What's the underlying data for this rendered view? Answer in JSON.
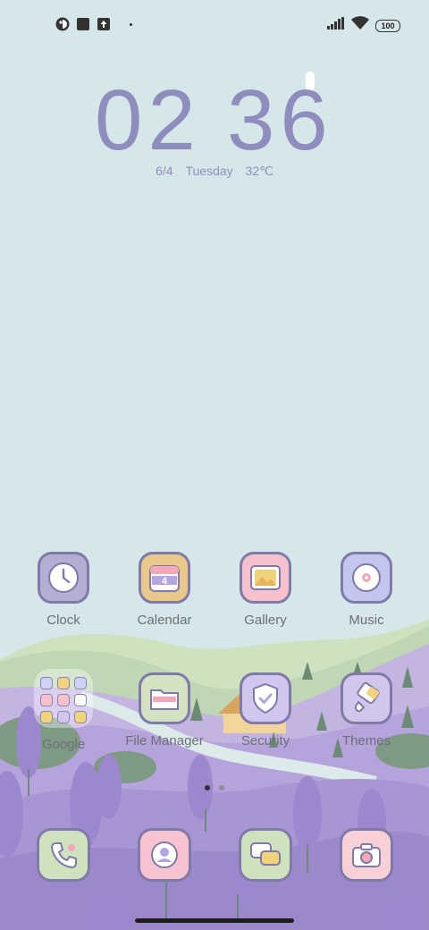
{
  "status_bar": {
    "left_icons": [
      "app-notification-icon",
      "stop-square-icon",
      "upload-icon",
      "more-dot-icon"
    ],
    "right_icons": [
      "signal-icon",
      "wifi-icon",
      "battery-icon"
    ],
    "battery_level": "100"
  },
  "clock": {
    "hour": "02",
    "minute": "36"
  },
  "date_line": {
    "date": "6/4",
    "weekday": "Tuesday",
    "temperature": "32℃"
  },
  "apps_row1": [
    {
      "label": "Clock",
      "icon": "clock-icon",
      "color": "#b3afd4"
    },
    {
      "label": "Calendar",
      "icon": "calendar-icon",
      "color": "#e9c98a"
    },
    {
      "label": "Gallery",
      "icon": "gallery-icon",
      "color": "#f6c0cc"
    },
    {
      "label": "Music",
      "icon": "music-disc-icon",
      "color": "#c2c6ef"
    }
  ],
  "apps_row2": [
    {
      "label": "Google",
      "icon": "folder-icon"
    },
    {
      "label": "File Manager",
      "icon": "file-manager-icon",
      "color": "#d3e3c2"
    },
    {
      "label": "Security",
      "icon": "shield-icon",
      "color": "#d1c7ee"
    },
    {
      "label": "Themes",
      "icon": "paintbrush-icon",
      "color": "#d3c6ec"
    }
  ],
  "calendar_day": "4",
  "dock": [
    {
      "icon": "phone-icon",
      "color": "#cfe2c0"
    },
    {
      "icon": "contacts-icon",
      "color": "#f7c3d1"
    },
    {
      "icon": "messages-icon",
      "color": "#cfe2c0"
    },
    {
      "icon": "camera-icon",
      "color": "#f9d0d5"
    }
  ],
  "page_indicator": {
    "count": 2,
    "active": 1
  },
  "colors": {
    "accent": "#8f8dbd",
    "lavender": "#b8a6dc",
    "sky": "#d6e7e9"
  }
}
